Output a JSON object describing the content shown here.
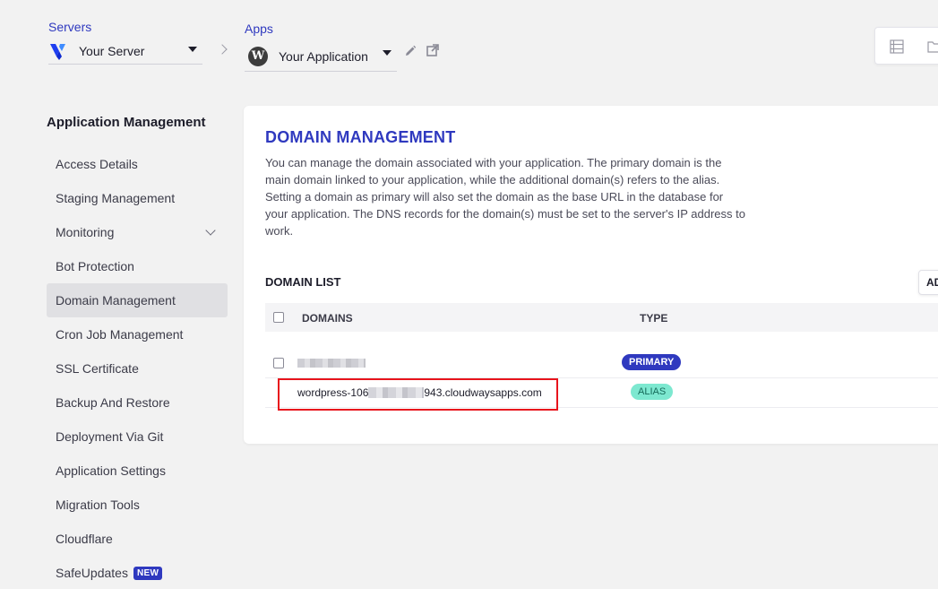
{
  "header": {
    "servers": {
      "label": "Servers",
      "value": "Your Server"
    },
    "apps": {
      "label": "Apps",
      "value": "Your Application"
    }
  },
  "sidebar": {
    "title": "Application Management",
    "items": [
      {
        "label": "Access Details"
      },
      {
        "label": "Staging Management"
      },
      {
        "label": "Monitoring"
      },
      {
        "label": "Bot Protection"
      },
      {
        "label": "Domain Management"
      },
      {
        "label": "Cron Job Management"
      },
      {
        "label": "SSL Certificate"
      },
      {
        "label": "Backup And Restore"
      },
      {
        "label": "Deployment Via Git"
      },
      {
        "label": "Application Settings"
      },
      {
        "label": "Migration Tools"
      },
      {
        "label": "Cloudflare"
      },
      {
        "label": "SafeUpdates",
        "badge": "NEW"
      }
    ],
    "active_item": "Domain Management"
  },
  "main": {
    "title": "DOMAIN MANAGEMENT",
    "description": "You can manage the domain associated with your application. The primary domain is the main domain linked to your application, while the additional domain(s) refers to the alias. Setting a domain as primary will also set the domain as the base URL in the database for your application. The DNS records for the domain(s) must be set to the server's IP address to work.",
    "domain_list": {
      "title": "DOMAIN LIST",
      "add_button_label": "AD",
      "columns": [
        "DOMAINS",
        "TYPE"
      ],
      "rows": [
        {
          "domain": "",
          "type": "PRIMARY"
        },
        {
          "domain_prefix": "wordpress-106",
          "domain_suffix": "943.cloudwaysapps.com",
          "type": "ALIAS"
        }
      ]
    }
  },
  "colors": {
    "accent": "#2f39bf",
    "alias_badge": "#7de8d0",
    "highlight": "#e8141c"
  },
  "icons": [
    "vultr-logo-icon",
    "wordpress-logo-icon",
    "chevron-right-icon",
    "edit-icon",
    "external-link-icon",
    "list-icon",
    "folder-icon",
    "chevron-down-icon"
  ]
}
